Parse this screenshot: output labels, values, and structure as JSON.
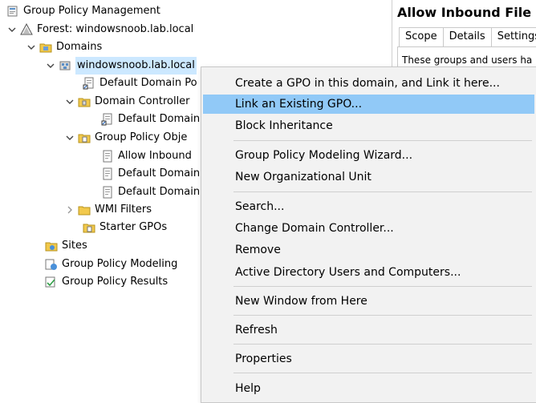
{
  "tree": {
    "root": "Group Policy Management",
    "forest": "Forest: windowsnoob.lab.local",
    "domains": "Domains",
    "domain": "windowsnoob.lab.local",
    "default_domain_policy": "Default Domain Po",
    "domain_controllers": "Domain Controller",
    "default_domain_controllers": "Default Domain",
    "gpo_objects": "Group Policy Obje",
    "allow_inbound": "Allow Inbound",
    "default_domain_1": "Default Domain",
    "default_domain_2": "Default Domain",
    "wmi_filters": "WMI Filters",
    "starter_gpos": "Starter GPOs",
    "sites": "Sites",
    "gp_modeling": "Group Policy Modeling",
    "gp_results": "Group Policy Results"
  },
  "right_pane": {
    "title": "Allow Inbound File a",
    "tabs": [
      "Scope",
      "Details",
      "Settings"
    ],
    "text": "These groups and users ha"
  },
  "menu": {
    "items": [
      "Create a GPO in this domain, and Link it here...",
      "Link an Existing GPO...",
      "Block Inheritance",
      "Group Policy Modeling Wizard...",
      "New Organizational Unit",
      "Search...",
      "Change Domain Controller...",
      "Remove",
      "Active Directory Users and Computers...",
      "New Window from Here",
      "Refresh",
      "Properties",
      "Help"
    ]
  },
  "colors": {
    "selection": "#cce8ff",
    "menu_highlight": "#91c9f7",
    "menu_bg": "#f2f2f2"
  }
}
